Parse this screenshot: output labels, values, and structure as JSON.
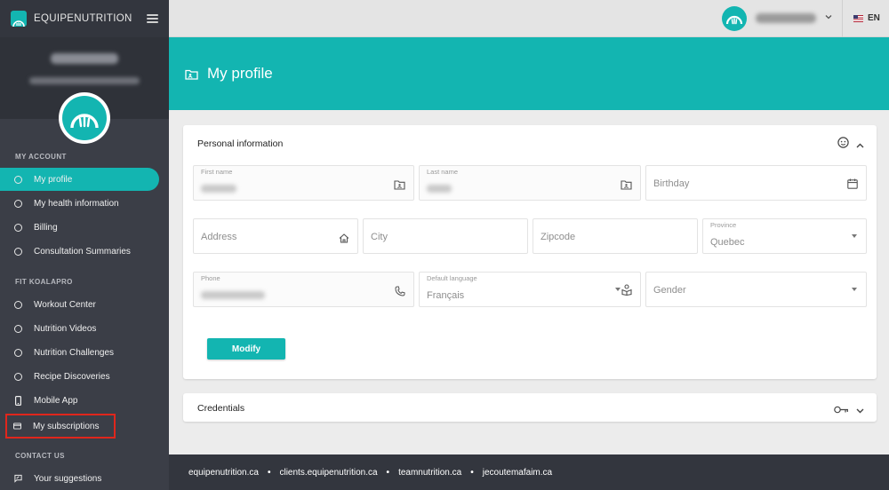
{
  "brand": {
    "name": "EQUIPENUTRITION",
    "accent": "#13b5b1",
    "sidebar_bg": "#3b3e47"
  },
  "sidebar": {
    "sections": [
      {
        "title": "MY ACCOUNT",
        "items": [
          {
            "label": "My profile",
            "icon": "circle-icon",
            "active": true
          },
          {
            "label": "My health information",
            "icon": "circle-icon"
          },
          {
            "label": "Billing",
            "icon": "circle-icon"
          },
          {
            "label": "Consultation Summaries",
            "icon": "circle-icon"
          }
        ]
      },
      {
        "title": "FIT KOALAPRO",
        "items": [
          {
            "label": "Workout Center",
            "icon": "circle-icon"
          },
          {
            "label": "Nutrition Videos",
            "icon": "circle-icon"
          },
          {
            "label": "Nutrition Challenges",
            "icon": "circle-icon"
          },
          {
            "label": "Recipe Discoveries",
            "icon": "circle-icon"
          },
          {
            "label": "Mobile App",
            "icon": "phone-icon"
          },
          {
            "label": "My subscriptions",
            "icon": "card-icon",
            "highlighted": true
          }
        ]
      },
      {
        "title": "CONTACT US",
        "items": [
          {
            "label": "Your suggestions",
            "icon": "feedback-icon"
          }
        ]
      }
    ]
  },
  "topbar": {
    "language": "EN"
  },
  "page": {
    "title": "My profile"
  },
  "personal": {
    "title": "Personal information",
    "fields": {
      "first_name": {
        "label": "First name"
      },
      "last_name": {
        "label": "Last name"
      },
      "birthday": {
        "placeholder": "Birthday"
      },
      "address": {
        "placeholder": "Address"
      },
      "city": {
        "placeholder": "City"
      },
      "zipcode": {
        "placeholder": "Zipcode"
      },
      "province": {
        "label": "Province",
        "value": "Quebec"
      },
      "phone": {
        "label": "Phone"
      },
      "default_language": {
        "label": "Default language",
        "value": "Français"
      },
      "gender": {
        "placeholder": "Gender"
      }
    },
    "modify_label": "Modify"
  },
  "credentials": {
    "title": "Credentials"
  },
  "footer": {
    "links": [
      "equipenutrition.ca",
      "clients.equipenutrition.ca",
      "teamnutrition.ca",
      "jecoutemafaim.ca"
    ]
  }
}
